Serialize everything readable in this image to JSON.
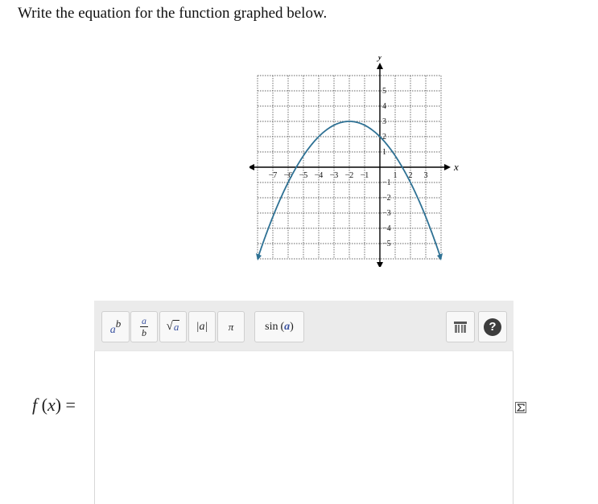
{
  "question": {
    "prompt": "Write the equation for the function graphed below."
  },
  "graph": {
    "x_axis_label": "x",
    "y_axis_label": "y",
    "x_ticks": [
      "−7",
      "−6",
      "−5",
      "−4",
      "−3",
      "−2",
      "−1",
      "1",
      "2",
      "3"
    ],
    "y_ticks": [
      "5",
      "4",
      "3",
      "2",
      "1",
      "−1",
      "−2",
      "−3",
      "−4",
      "−5"
    ],
    "grid_range": {
      "x": [
        -8,
        4
      ],
      "y": [
        -6,
        6
      ]
    },
    "curve_color": "#2e7194",
    "curve": {
      "vertex": [
        -2,
        3
      ],
      "leading_coefficient": -0.25,
      "x_start": -8,
      "x_end": 4
    }
  },
  "toolbar": {
    "power": {
      "base": "a",
      "exponent": "b"
    },
    "fraction": {
      "numerator": "a",
      "denominator": "b"
    },
    "sqrt": {
      "symbol": "√",
      "arg": "a"
    },
    "abs": {
      "text": "|a|"
    },
    "pi": {
      "text": "π"
    },
    "sin": {
      "func": "sin",
      "arg": "a"
    },
    "icons": [
      "keyboard-icon",
      "help-icon",
      "sigma-icon"
    ],
    "help_text": "?"
  },
  "answer": {
    "label_func": "f",
    "label_var": "x",
    "label_rest": ") =",
    "value": ""
  }
}
